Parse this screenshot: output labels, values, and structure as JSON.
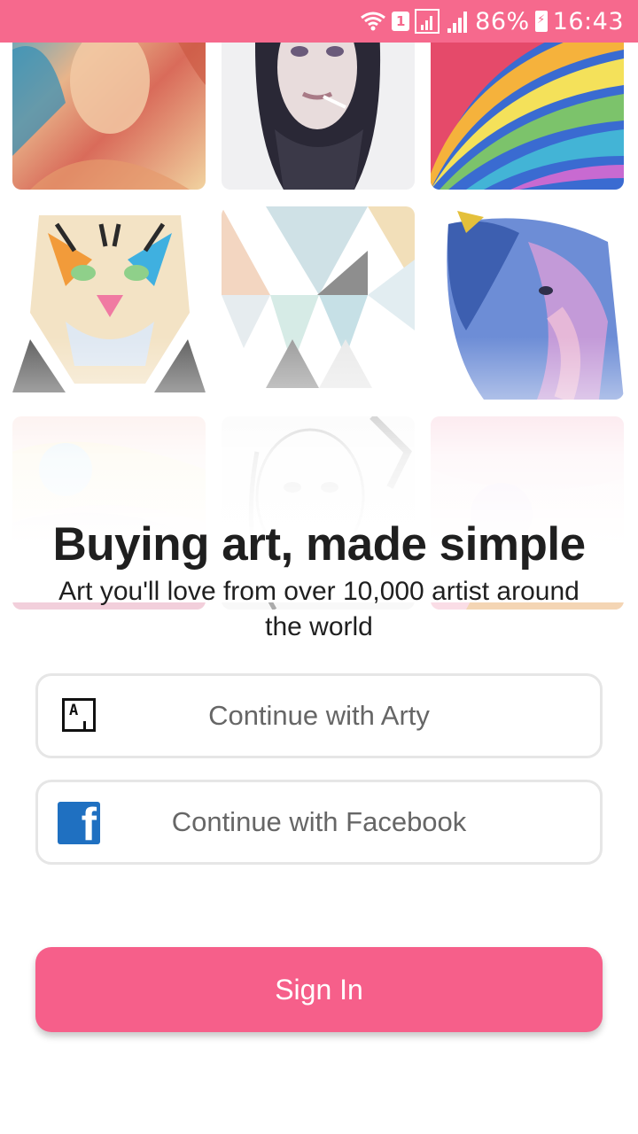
{
  "status_bar": {
    "sim_slot": "1",
    "battery": "86%",
    "time": "16:43"
  },
  "artworks": [
    {
      "icon": "portrait-woman-painting"
    },
    {
      "icon": "portrait-woman-smoking"
    },
    {
      "icon": "rainbow-swirls"
    },
    {
      "icon": "tiger-illustration"
    },
    {
      "icon": "geometric-triangles"
    },
    {
      "icon": "elephant-painting"
    },
    {
      "icon": "abstract-colors"
    },
    {
      "icon": "sketch-portrait"
    },
    {
      "icon": "colorful-abstract"
    }
  ],
  "headline": "Buying art, made simple",
  "subtitle": "Art you'll love from over 10,000 artist around the world",
  "buttons": {
    "arty": {
      "label": "Continue with Arty",
      "logo_text": "A"
    },
    "facebook": {
      "label": "Continue with Facebook",
      "logo_text": "f"
    },
    "signin": {
      "label": "Sign In"
    }
  },
  "colors": {
    "brand": "#f65f8a",
    "statusbar": "#f6698d",
    "facebook": "#1f70c1"
  }
}
